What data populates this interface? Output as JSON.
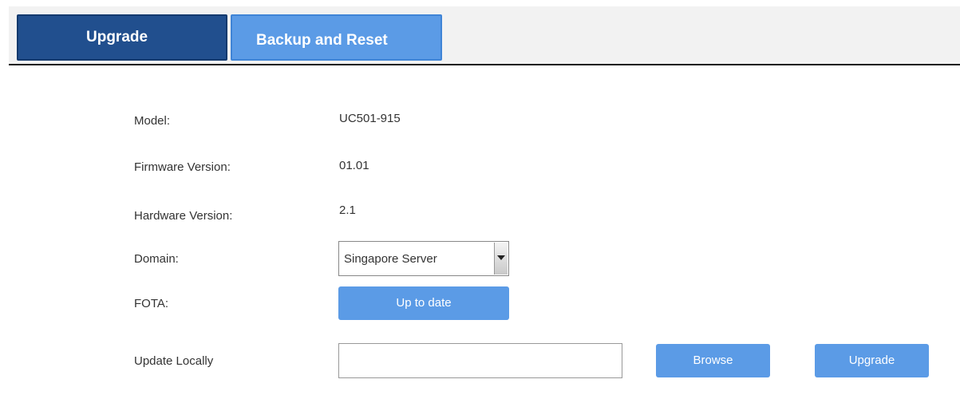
{
  "tabs": {
    "upgrade_label": "Upgrade",
    "backup_label": "Backup and Reset"
  },
  "form": {
    "model_label": "Model:",
    "model_value": "UC501-915",
    "firmware_label": "Firmware Version:",
    "firmware_value": "01.01",
    "hardware_label": "Hardware Version:",
    "hardware_value": "2.1",
    "domain_label": "Domain:",
    "domain_selected": "Singapore Server",
    "fota_label": "FOTA:",
    "fota_button": "Up to date",
    "update_locally_label": "Update Locally",
    "file_value": "",
    "browse_button": "Browse",
    "upgrade_button": "Upgrade"
  },
  "colors": {
    "tab_active": "#214f8e",
    "accent": "#5b9be6",
    "tab_bar_bg": "#f2f2f2"
  }
}
